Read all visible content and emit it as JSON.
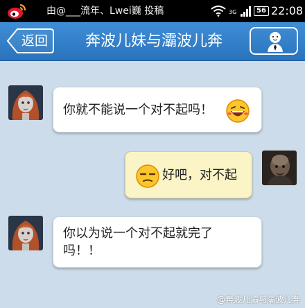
{
  "status_bar": {
    "notification_text": "由@___流年、Lwei巍 投稿",
    "signal_label": "3G",
    "battery_level": "56",
    "time": "22:08"
  },
  "nav": {
    "back_label": "返回",
    "title": "奔波儿妹与灞波儿奔"
  },
  "messages": [
    {
      "direction": "incoming",
      "text": "你就不能说一个对不起吗！",
      "emoji": "laughing-face"
    },
    {
      "direction": "outgoing",
      "text": "好吧，对不起",
      "emoji": "smirking-face"
    },
    {
      "direction": "incoming",
      "text": "你以为说一个对不起就完了吗！！"
    }
  ],
  "watermark": "@奔波儿灞与灞波儿奔",
  "colors": {
    "nav_blue": "#2f7fcc",
    "background": "#cddcea",
    "incoming_bubble": "#ffffff",
    "outgoing_bubble": "#fbf4c6"
  }
}
